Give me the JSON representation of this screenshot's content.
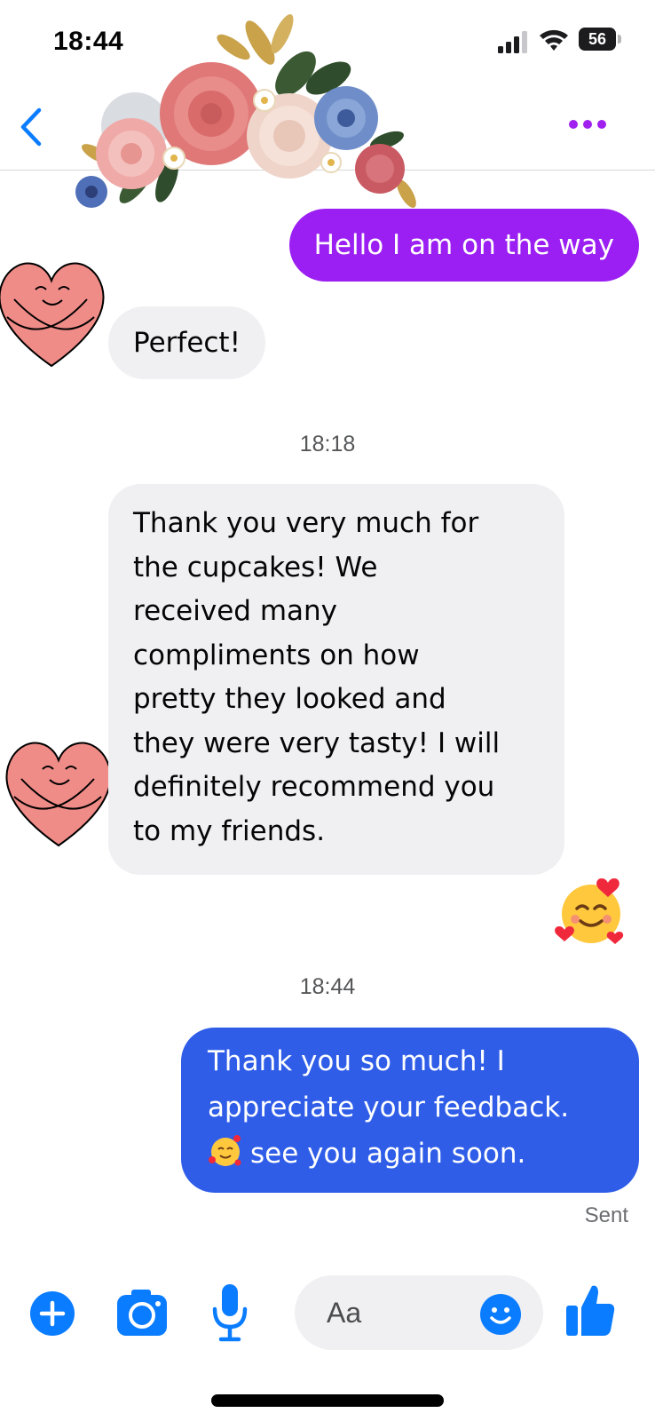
{
  "status_bar": {
    "time": "18:44",
    "battery_level": "56",
    "icons": [
      "signal-icon",
      "wifi-icon",
      "battery-icon"
    ]
  },
  "header": {
    "icons": [
      "back-arrow-icon",
      "more-options-icon",
      "flower-decoration"
    ]
  },
  "colors": {
    "accent": "#0a7cff",
    "sent_purple": "#9b1ff2",
    "sent_blue": "#2f5de8",
    "received_bubble": "#f0f0f3"
  },
  "messages": [
    {
      "direction": "outgoing",
      "text": "Hello I am on the way"
    },
    {
      "direction": "incoming",
      "text": "Perfect!"
    },
    {
      "type": "timestamp",
      "text": "18:18"
    },
    {
      "direction": "incoming",
      "lines": [
        "Thank you very much for",
        "the cupcakes! We",
        "received many",
        "compliments on how",
        "pretty they looked and",
        "they were very tasty! I will",
        "definitely recommend you",
        "to my friends."
      ],
      "reaction": "smiling-face-with-hearts"
    },
    {
      "type": "timestamp",
      "text": "18:44"
    },
    {
      "direction": "outgoing",
      "lines": [
        "Thank you so much! I",
        "appreciate your feedback.",
        "see you again soon."
      ],
      "inline_emoji": "smiling-face-with-hearts"
    }
  ],
  "sent_status": "Sent",
  "composer": {
    "placeholder": "Aa",
    "icons": [
      "plus-icon",
      "camera-icon",
      "microphone-icon",
      "emoji-icon",
      "thumbs-up-icon"
    ]
  }
}
